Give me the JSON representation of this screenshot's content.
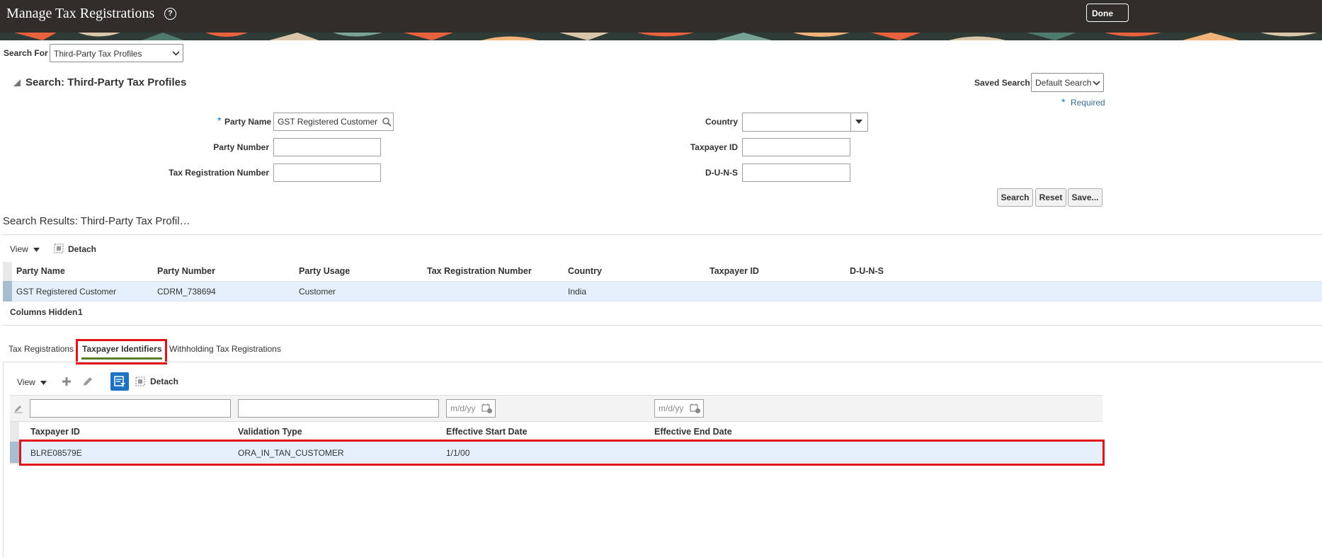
{
  "header": {
    "title": "Manage Tax Registrations",
    "done_label": "Done"
  },
  "search_for": {
    "label": "Search For",
    "value": "Third-Party Tax Profiles"
  },
  "search": {
    "title": "Search: Third-Party Tax Profiles",
    "saved_search_label": "Saved Search",
    "saved_search_value": "Default Search",
    "required_marker": "*",
    "required_label": "Required",
    "fields": {
      "party_name_label": "Party Name",
      "party_name_value": "GST Registered Customer",
      "party_number_label": "Party Number",
      "tax_reg_label": "Tax Registration Number",
      "country_label": "Country",
      "taxpayer_id_label": "Taxpayer ID",
      "duns_label": "D-U-N-S"
    },
    "buttons": {
      "search": "Search",
      "reset": "Reset",
      "save": "Save..."
    }
  },
  "results": {
    "title": "Search Results: Third-Party Tax Profil…",
    "view_label": "View",
    "detach_label": "Detach",
    "columns": [
      "Party Name",
      "Party Number",
      "Party Usage",
      "Tax Registration Number",
      "Country",
      "Taxpayer ID",
      "D-U-N-S"
    ],
    "rows": [
      {
        "party_name": "GST Registered Customer",
        "party_number": "CDRM_738694",
        "party_usage": "Customer",
        "tax_reg": "",
        "country": "India",
        "taxpayer_id": "",
        "duns": ""
      }
    ],
    "columns_hidden_label": "Columns Hidden",
    "columns_hidden_count": "1"
  },
  "tabs": [
    {
      "label": "Tax Registrations",
      "selected": false
    },
    {
      "label": "Taxpayer Identifiers",
      "selected": true
    },
    {
      "label": "Withholding Tax Registrations",
      "selected": false
    }
  ],
  "identifiers": {
    "view_label": "View",
    "detach_label": "Detach",
    "date_placeholder": "m/d/yy",
    "columns": [
      "Taxpayer ID",
      "Validation Type",
      "Effective Start Date",
      "Effective End Date"
    ],
    "rows": [
      {
        "taxpayer_id": "BLRE08579E",
        "validation_type": "ORA_IN_TAN_CUSTOMER",
        "start_date": "1/1/00",
        "end_date": ""
      }
    ]
  },
  "colors": {
    "header_bg": "#312d2a",
    "highlight_red": "#e0131a",
    "selected_row": "#e5f0fa",
    "tab_underline": "#5a7d2a",
    "qbe_button": "#1d72c4"
  }
}
